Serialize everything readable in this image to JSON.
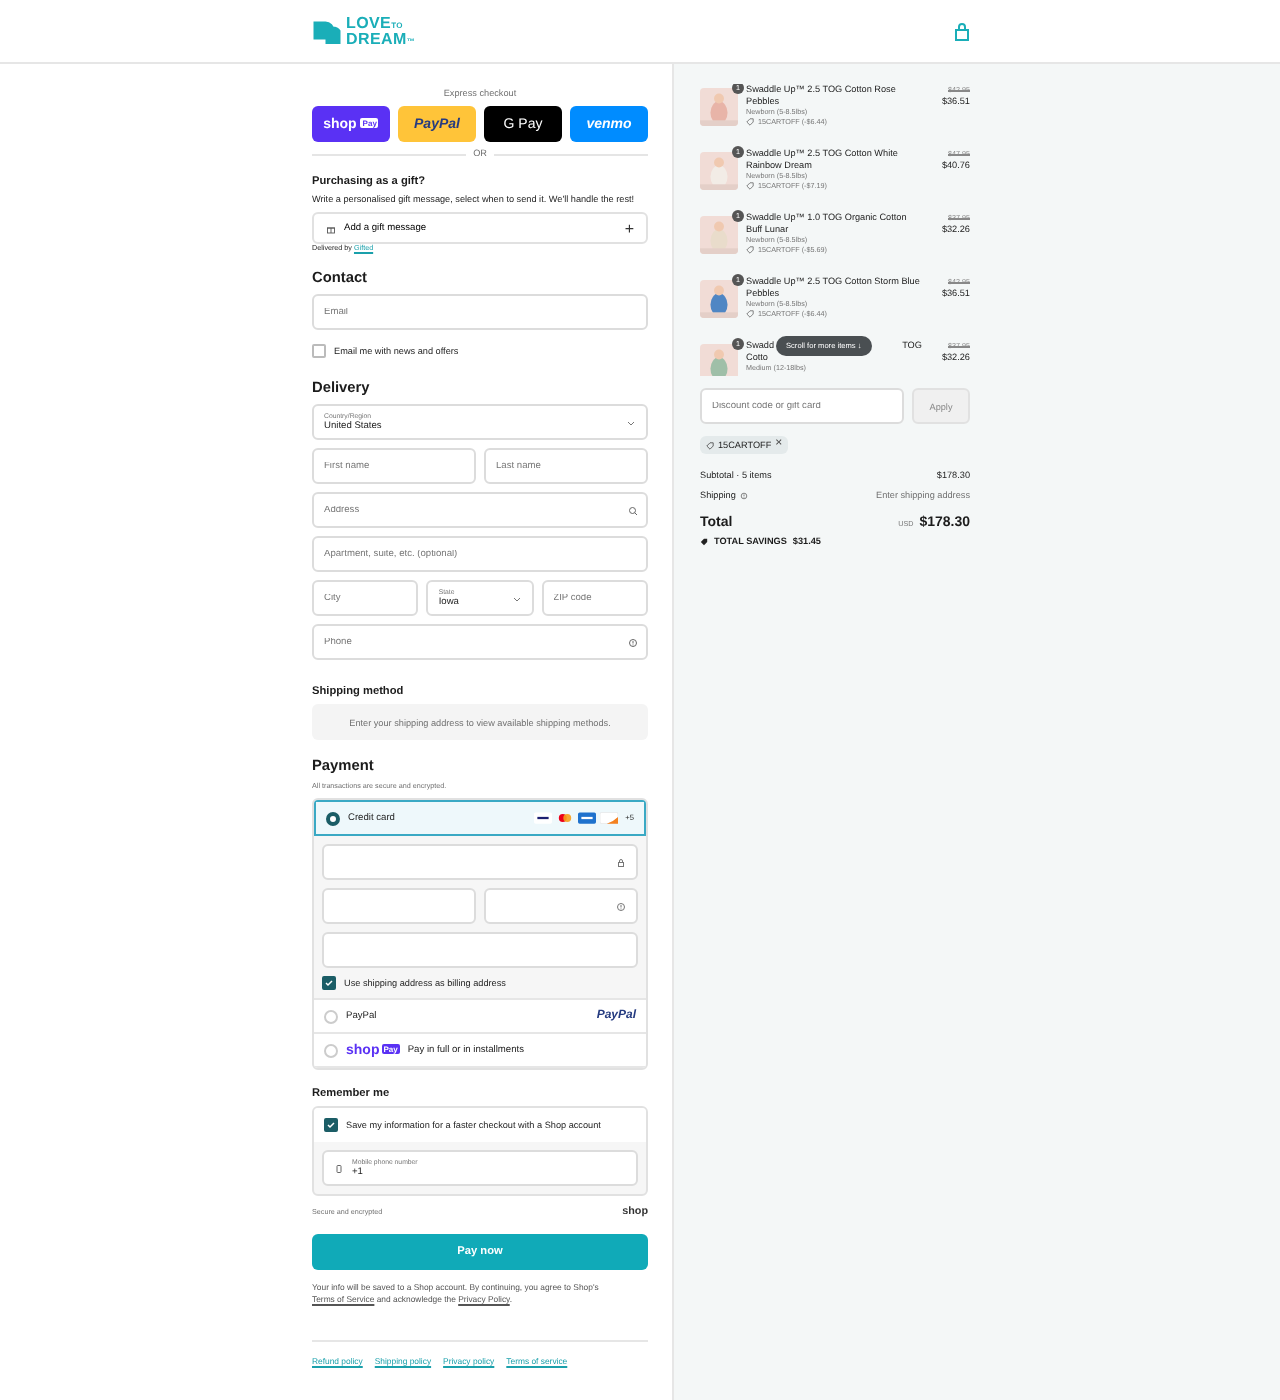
{
  "header": {
    "logo": {
      "top": "LOVE",
      "small": "TO",
      "bottom": "DREAM",
      "mark": "™"
    }
  },
  "express": {
    "label": "Express checkout",
    "buttons": [
      {
        "kind": "shop",
        "text": "shop",
        "badge": "Pay"
      },
      {
        "kind": "paypal",
        "text": "PayPal"
      },
      {
        "kind": "gpay",
        "text": "G Pay"
      },
      {
        "kind": "venmo",
        "text": "venmo"
      }
    ],
    "divider": "OR"
  },
  "gift": {
    "title": "Purchasing as a gift?",
    "description": "Write a personalised gift message, select when to send it. We'll handle the rest!",
    "button": "Add a gift message",
    "plus": "+",
    "delivered_by": "Delivered by",
    "delivered_link": "Gifted"
  },
  "contact": {
    "title": "Contact",
    "email": {
      "placeholder": "Email"
    },
    "news": {
      "label": "Email me with news and offers",
      "checked": false
    }
  },
  "delivery": {
    "title": "Delivery",
    "country_label": "Country/Region",
    "country": "United States",
    "first_name": {
      "placeholder": "First name"
    },
    "last_name": {
      "placeholder": "Last name"
    },
    "address": {
      "placeholder": "Address"
    },
    "apartment": {
      "placeholder": "Apartment, suite, etc. (optional)"
    },
    "city": {
      "placeholder": "City"
    },
    "state_label": "State",
    "state": "Iowa",
    "zip": {
      "placeholder": "ZIP code"
    },
    "phone": {
      "placeholder": "Phone"
    }
  },
  "shipping": {
    "title": "Shipping method",
    "message": "Enter your shipping address to view available shipping methods."
  },
  "payment": {
    "title": "Payment",
    "subtitle": "All transactions are secure and encrypted.",
    "methods": [
      {
        "kind": "card",
        "label": "Credit card",
        "selected": true,
        "more": "+5",
        "billing": {
          "label": "Use shipping address as billing address",
          "checked": true
        }
      },
      {
        "kind": "paypal",
        "label": "PayPal",
        "selected": false,
        "logo": "PayPal"
      },
      {
        "kind": "shoppay",
        "label": "Pay in full or in installments",
        "selected": false,
        "logo": "shop",
        "badge": "Pay"
      }
    ]
  },
  "remember": {
    "title": "Remember me",
    "save": {
      "label": "Save my information for a faster checkout with a Shop account",
      "checked": true
    },
    "phone_label": "Mobile phone number",
    "phone_value": "+1",
    "secure": "Secure and encrypted",
    "shop": "shop"
  },
  "pay_button": "Pay now",
  "disclaimer": {
    "before": "Your info will be saved to a Shop account. By continuing, you agree to Shop's",
    "terms": "Terms of Service",
    "middle": "and acknowledge the",
    "privacy": "Privacy Policy",
    "end": "."
  },
  "footer_links": [
    "Refund policy",
    "Shipping policy",
    "Privacy policy",
    "Terms of service"
  ],
  "cart": {
    "items": [
      {
        "quantity": "1",
        "title": "Swaddle Up™ 2.5 TOG Cotton Rose Pebbles",
        "variant": "Newborn (5-8.5lbs)",
        "discount": "15CARTOFF (-$6.44)",
        "original": "$42.95",
        "price": "$36.51"
      },
      {
        "quantity": "1",
        "title": "Swaddle Up™ 2.5 TOG Cotton White Rainbow Dream",
        "variant": "Newborn (5-8.5lbs)",
        "discount": "15CARTOFF (-$7.19)",
        "original": "$47.95",
        "price": "$40.76"
      },
      {
        "quantity": "1",
        "title": "Swaddle Up™ 1.0 TOG Organic Cotton Buff Lunar",
        "variant": "Newborn (5-8.5lbs)",
        "discount": "15CARTOFF (-$5.69)",
        "original": "$37.95",
        "price": "$32.26"
      },
      {
        "quantity": "1",
        "title": "Swaddle Up™ 2.5 TOG Cotton Storm Blue Pebbles",
        "variant": "Newborn (5-8.5lbs)",
        "discount": "15CARTOFF (-$6.44)",
        "original": "$42.95",
        "price": "$36.51"
      },
      {
        "quantity": "1",
        "title_start": "Swadd",
        "title_end": "TOG",
        "title_line2": "Cotto",
        "variant": "Medium (12-18lbs)",
        "original": "$37.95",
        "price": "$32.26"
      }
    ],
    "scroll_hint": "Scroll for more items",
    "scroll_arrow": "↓",
    "discount": {
      "placeholder": "Discount code or gift card"
    },
    "apply": "Apply",
    "code": "15CARTOFF",
    "code_remove": "×",
    "subtotal_label": "Subtotal · 5 items",
    "subtotal": "$178.30",
    "shipping_label": "Shipping",
    "shipping_value": "Enter shipping address",
    "total_label": "Total",
    "currency": "USD",
    "total": "$178.30",
    "savings_label": "TOTAL SAVINGS",
    "savings": "$31.45"
  }
}
